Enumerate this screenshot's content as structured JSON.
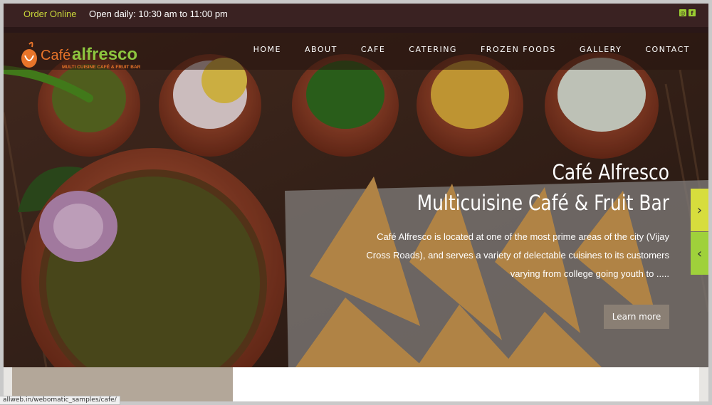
{
  "topbar": {
    "order_online": "Order Online",
    "hours": "Open daily: 10:30 am to 11:00 pm",
    "social": [
      {
        "icon": "instagram-icon",
        "glyph": "◎"
      },
      {
        "icon": "facebook-icon",
        "glyph": "f"
      }
    ]
  },
  "brand": {
    "name_part1": "Café",
    "name_part2": "alfresco",
    "tagline": "MULTI CUISINE CAFÉ & FRUIT BAR"
  },
  "nav": {
    "items": [
      "HOME",
      "ABOUT",
      "CAFE",
      "CATERING",
      "FROZEN FOODS",
      "GALLERY",
      "CONTACT"
    ]
  },
  "hero": {
    "title": "Café Alfresco",
    "subtitle": "Multicuisine Café & Fruit Bar",
    "description": "Café Alfresco is located at one of the most prime areas of the city (Vijay Cross Roads), and serves a variety of delectable cuisines to its customers varying from college going youth to .....",
    "cta": "Learn more",
    "next_glyph": "›",
    "prev_glyph": "‹"
  },
  "status_bar": {
    "url": "allweb.in/webomatic_samples/cafe/"
  },
  "colors": {
    "topbar_bg": "#3a2222",
    "accent_green": "#c8d63a",
    "next_arrow": "#d7dd3d",
    "prev_arrow": "#9fd13b",
    "button_bg": "#8a7f74"
  }
}
